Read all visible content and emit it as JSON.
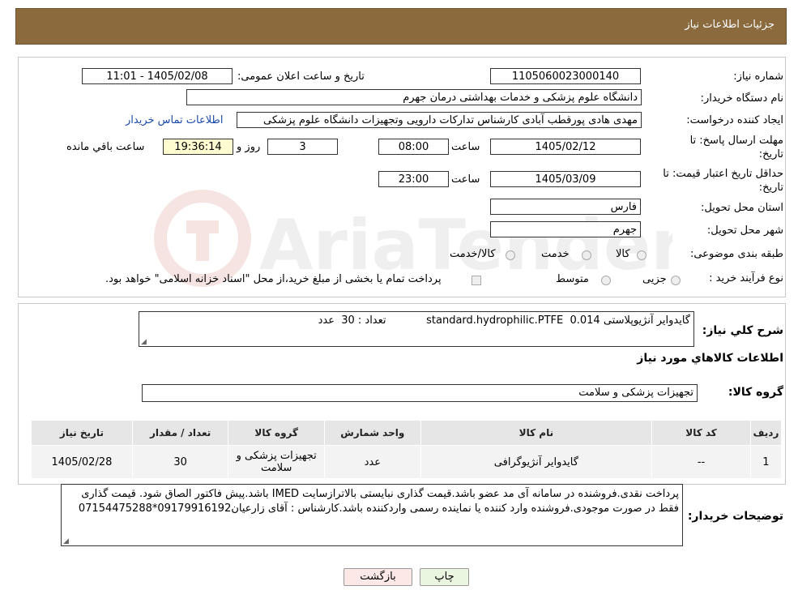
{
  "header": {
    "title": "جزئیات اطلاعات نیاز"
  },
  "form": {
    "need_number_label": "شماره نیاز:",
    "need_number_value": "1105060023000140",
    "announce_label": "تاریخ و ساعت اعلان عمومی:",
    "announce_value": "1405/02/08 - 11:01",
    "buyer_label": "نام دستگاه خریدار:",
    "buyer_value": "دانشگاه علوم پزشکی و خدمات بهداشتی  درمان جهرم",
    "creator_label": "ایجاد کننده درخواست:",
    "creator_value": "مهدی هادی پورقطب آبادی کارشناس تدارکات دارویی وتجهیزات دانشگاه علوم پزشکی",
    "contact_link": "اطلاعات تماس خریدار",
    "deadline_label_1": "مهلت ارسال پاسخ: تا",
    "deadline_label_2": "تاریخ:",
    "deadline_date": "1405/02/12",
    "time_label": "ساعت",
    "deadline_time": "08:00",
    "days_value": "3",
    "days_label": "روز و",
    "remaining_time": "19:36:14",
    "remaining_label": "ساعت باقي مانده",
    "validity_label_1": "حداقل تاریخ اعتبار قیمت: تا",
    "validity_label_2": "تاریخ:",
    "validity_date": "1405/03/09",
    "validity_time": "23:00",
    "province_label": "استان محل تحویل:",
    "province_value": "فارس",
    "city_label": "شهر محل تحویل:",
    "city_value": "جهرم",
    "category_label": "طبقه بندی موضوعی:",
    "category_options": [
      "کالا",
      "خدمت",
      "کالا/خدمت"
    ],
    "purchase_type_label": "نوع فرآیند خرید :",
    "purchase_options": [
      "جزیی",
      "متوسط"
    ],
    "purchase_note": "پرداخت تمام یا بخشی از مبلغ خرید،از محل \"اسناد خزانه اسلامی\" خواهد بود."
  },
  "summary": {
    "label": "شرح کلي نیاز:",
    "text": "گایدوایر آنژیوپلاستی standard.hydrophilic.PTFE  0.014            تعداد : 30  عدد",
    "items_heading": "اطلاعات کالاهاي مورد نیاز",
    "group_label": "گروه کالا:",
    "group_value": "تجهیزات پزشکی و سلامت"
  },
  "table": {
    "headers": [
      "ردیف",
      "کد کالا",
      "نام کالا",
      "واحد شمارش",
      "گروه کالا",
      "تعداد / مقدار",
      "تاریخ نیاز"
    ],
    "rows": [
      [
        "1",
        "--",
        "گایدوایر آنژیوگرافی",
        "عدد",
        "تجهیزات پزشکی و سلامت",
        "30",
        "1405/02/28"
      ]
    ]
  },
  "notes": {
    "label": "توضیحات خریدار:",
    "text": "پرداخت نقدی.فروشنده در سامانه آی مد عضو باشد.قیمت گذاری نبایستی بالاترازسایت IMED باشد.پیش فاکتور الصاق شود. قیمت گذاری فقط در صورت موجودی.فروشنده وارد کننده یا نماینده رسمی واردکننده باشد.کارشناس : آقای زارعیان09179916192*07154475288"
  },
  "buttons": {
    "print": "چاپ",
    "back": "بازگشت"
  },
  "watermark": {
    "text": "AriaTender.neT"
  },
  "colors": {
    "header_bg": "#8b6a3e",
    "link": "#1a4aa8",
    "timer_bg": "#fffbd0",
    "back_bg": "#fde8e8",
    "print_bg": "#eaf6e0"
  }
}
